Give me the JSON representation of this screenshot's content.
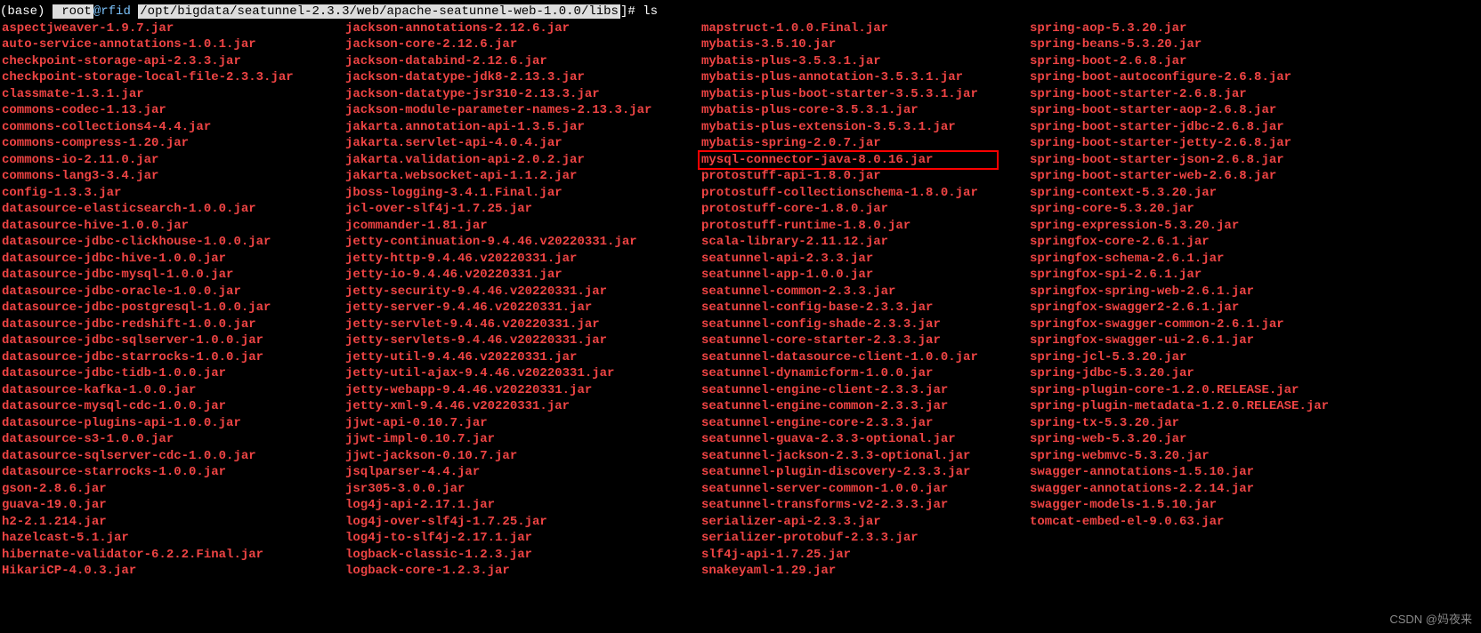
{
  "prompt": {
    "env": "(base)",
    "user": " root",
    "at": "@rfid ",
    "path": "/opt/bigdata/seatunnel-2.3.3/web/apache-seatunnel-web-1.0.0/libs",
    "suffix": "]# ",
    "cmd": "ls"
  },
  "highlighted_file": "mysql-connector-java-8.0.16.jar",
  "columns": [
    [
      "aspectjweaver-1.9.7.jar",
      "auto-service-annotations-1.0.1.jar",
      "checkpoint-storage-api-2.3.3.jar",
      "checkpoint-storage-local-file-2.3.3.jar",
      "classmate-1.3.1.jar",
      "commons-codec-1.13.jar",
      "commons-collections4-4.4.jar",
      "commons-compress-1.20.jar",
      "commons-io-2.11.0.jar",
      "commons-lang3-3.4.jar",
      "config-1.3.3.jar",
      "datasource-elasticsearch-1.0.0.jar",
      "datasource-hive-1.0.0.jar",
      "datasource-jdbc-clickhouse-1.0.0.jar",
      "datasource-jdbc-hive-1.0.0.jar",
      "datasource-jdbc-mysql-1.0.0.jar",
      "datasource-jdbc-oracle-1.0.0.jar",
      "datasource-jdbc-postgresql-1.0.0.jar",
      "datasource-jdbc-redshift-1.0.0.jar",
      "datasource-jdbc-sqlserver-1.0.0.jar",
      "datasource-jdbc-starrocks-1.0.0.jar",
      "datasource-jdbc-tidb-1.0.0.jar",
      "datasource-kafka-1.0.0.jar",
      "datasource-mysql-cdc-1.0.0.jar",
      "datasource-plugins-api-1.0.0.jar",
      "datasource-s3-1.0.0.jar",
      "datasource-sqlserver-cdc-1.0.0.jar",
      "datasource-starrocks-1.0.0.jar",
      "gson-2.8.6.jar",
      "guava-19.0.jar",
      "h2-2.1.214.jar",
      "hazelcast-5.1.jar",
      "hibernate-validator-6.2.2.Final.jar",
      "HikariCP-4.0.3.jar"
    ],
    [
      "jackson-annotations-2.12.6.jar",
      "jackson-core-2.12.6.jar",
      "jackson-databind-2.12.6.jar",
      "jackson-datatype-jdk8-2.13.3.jar",
      "jackson-datatype-jsr310-2.13.3.jar",
      "jackson-module-parameter-names-2.13.3.jar",
      "jakarta.annotation-api-1.3.5.jar",
      "jakarta.servlet-api-4.0.4.jar",
      "jakarta.validation-api-2.0.2.jar",
      "jakarta.websocket-api-1.1.2.jar",
      "jboss-logging-3.4.1.Final.jar",
      "jcl-over-slf4j-1.7.25.jar",
      "jcommander-1.81.jar",
      "jetty-continuation-9.4.46.v20220331.jar",
      "jetty-http-9.4.46.v20220331.jar",
      "jetty-io-9.4.46.v20220331.jar",
      "jetty-security-9.4.46.v20220331.jar",
      "jetty-server-9.4.46.v20220331.jar",
      "jetty-servlet-9.4.46.v20220331.jar",
      "jetty-servlets-9.4.46.v20220331.jar",
      "jetty-util-9.4.46.v20220331.jar",
      "jetty-util-ajax-9.4.46.v20220331.jar",
      "jetty-webapp-9.4.46.v20220331.jar",
      "jetty-xml-9.4.46.v20220331.jar",
      "jjwt-api-0.10.7.jar",
      "jjwt-impl-0.10.7.jar",
      "jjwt-jackson-0.10.7.jar",
      "jsqlparser-4.4.jar",
      "jsr305-3.0.0.jar",
      "log4j-api-2.17.1.jar",
      "log4j-over-slf4j-1.7.25.jar",
      "log4j-to-slf4j-2.17.1.jar",
      "logback-classic-1.2.3.jar",
      "logback-core-1.2.3.jar"
    ],
    [
      "mapstruct-1.0.0.Final.jar",
      "mybatis-3.5.10.jar",
      "mybatis-plus-3.5.3.1.jar",
      "mybatis-plus-annotation-3.5.3.1.jar",
      "mybatis-plus-boot-starter-3.5.3.1.jar",
      "mybatis-plus-core-3.5.3.1.jar",
      "mybatis-plus-extension-3.5.3.1.jar",
      "mybatis-spring-2.0.7.jar",
      "mysql-connector-java-8.0.16.jar",
      "protostuff-api-1.8.0.jar",
      "protostuff-collectionschema-1.8.0.jar",
      "protostuff-core-1.8.0.jar",
      "protostuff-runtime-1.8.0.jar",
      "scala-library-2.11.12.jar",
      "seatunnel-api-2.3.3.jar",
      "seatunnel-app-1.0.0.jar",
      "seatunnel-common-2.3.3.jar",
      "seatunnel-config-base-2.3.3.jar",
      "seatunnel-config-shade-2.3.3.jar",
      "seatunnel-core-starter-2.3.3.jar",
      "seatunnel-datasource-client-1.0.0.jar",
      "seatunnel-dynamicform-1.0.0.jar",
      "seatunnel-engine-client-2.3.3.jar",
      "seatunnel-engine-common-2.3.3.jar",
      "seatunnel-engine-core-2.3.3.jar",
      "seatunnel-guava-2.3.3-optional.jar",
      "seatunnel-jackson-2.3.3-optional.jar",
      "seatunnel-plugin-discovery-2.3.3.jar",
      "seatunnel-server-common-1.0.0.jar",
      "seatunnel-transforms-v2-2.3.3.jar",
      "serializer-api-2.3.3.jar",
      "serializer-protobuf-2.3.3.jar",
      "slf4j-api-1.7.25.jar",
      "snakeyaml-1.29.jar"
    ],
    [
      "spring-aop-5.3.20.jar",
      "spring-beans-5.3.20.jar",
      "spring-boot-2.6.8.jar",
      "spring-boot-autoconfigure-2.6.8.jar",
      "spring-boot-starter-2.6.8.jar",
      "spring-boot-starter-aop-2.6.8.jar",
      "spring-boot-starter-jdbc-2.6.8.jar",
      "spring-boot-starter-jetty-2.6.8.jar",
      "spring-boot-starter-json-2.6.8.jar",
      "spring-boot-starter-web-2.6.8.jar",
      "spring-context-5.3.20.jar",
      "spring-core-5.3.20.jar",
      "spring-expression-5.3.20.jar",
      "springfox-core-2.6.1.jar",
      "springfox-schema-2.6.1.jar",
      "springfox-spi-2.6.1.jar",
      "springfox-spring-web-2.6.1.jar",
      "springfox-swagger2-2.6.1.jar",
      "springfox-swagger-common-2.6.1.jar",
      "springfox-swagger-ui-2.6.1.jar",
      "spring-jcl-5.3.20.jar",
      "spring-jdbc-5.3.20.jar",
      "spring-plugin-core-1.2.0.RELEASE.jar",
      "spring-plugin-metadata-1.2.0.RELEASE.jar",
      "spring-tx-5.3.20.jar",
      "spring-web-5.3.20.jar",
      "spring-webmvc-5.3.20.jar",
      "swagger-annotations-1.5.10.jar",
      "swagger-annotations-2.2.14.jar",
      "swagger-models-1.5.10.jar",
      "tomcat-embed-el-9.0.63.jar"
    ]
  ],
  "watermark": "CSDN @妈夜来"
}
